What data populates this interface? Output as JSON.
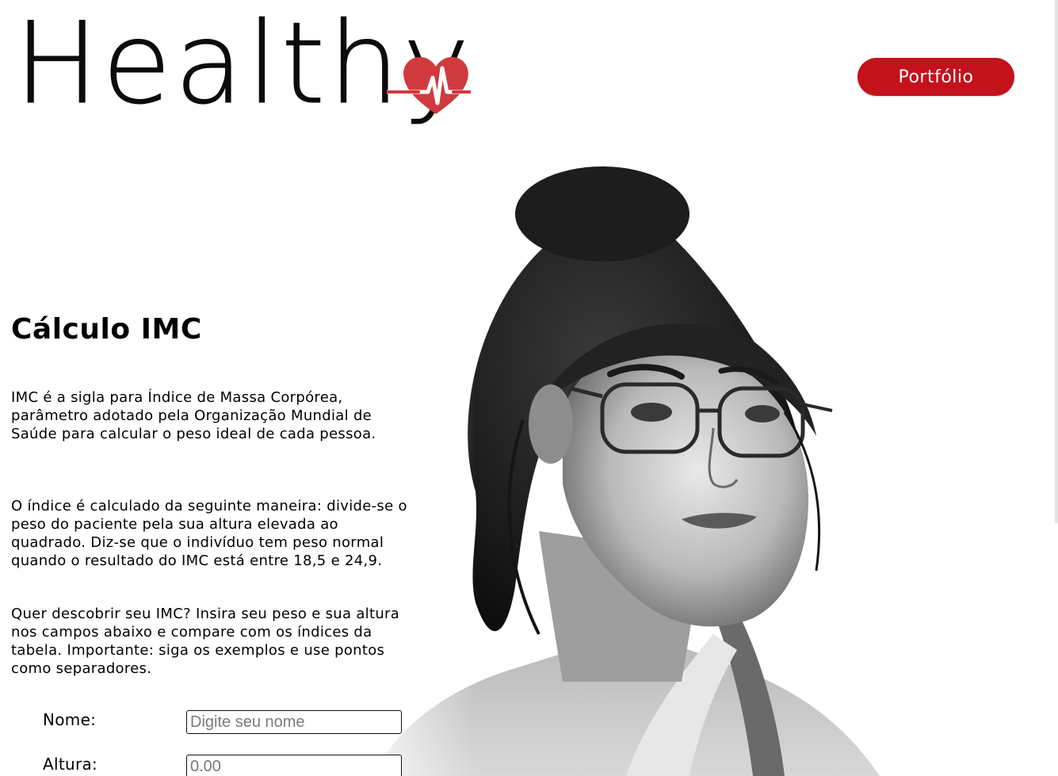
{
  "header": {
    "logo_text": "Healthy",
    "portfolio_label": "Portfólio"
  },
  "colors": {
    "accent": "#c3121c",
    "heart": "#d03a3f",
    "text": "#0b0b0b"
  },
  "icons": {
    "logo_mark": "heartbeat-heart-icon"
  },
  "main": {
    "title": "Cálculo IMC",
    "paragraphs": [
      "IMC é a sigla para Índice de Massa Corpórea, parâmetro adotado pela Organização Mundial de Saúde para calcular o peso ideal de cada pessoa.",
      "O índice é calculado da seguinte maneira: divide-se o peso do paciente pela sua altura elevada ao quadrado. Diz-se que o indivíduo tem peso normal quando o resultado do IMC está entre 18,5 e 24,9.",
      "Quer descobrir seu IMC? Insira seu peso e sua altura nos campos abaixo e compare com os índices da tabela. Importante: siga os exemplos e use pontos como separadores."
    ]
  },
  "form": {
    "nome_label": "Nome:",
    "nome_placeholder": "Digite seu nome",
    "nome_value": "",
    "altura_label": "Altura:",
    "altura_placeholder": "0.00",
    "altura_value": ""
  }
}
